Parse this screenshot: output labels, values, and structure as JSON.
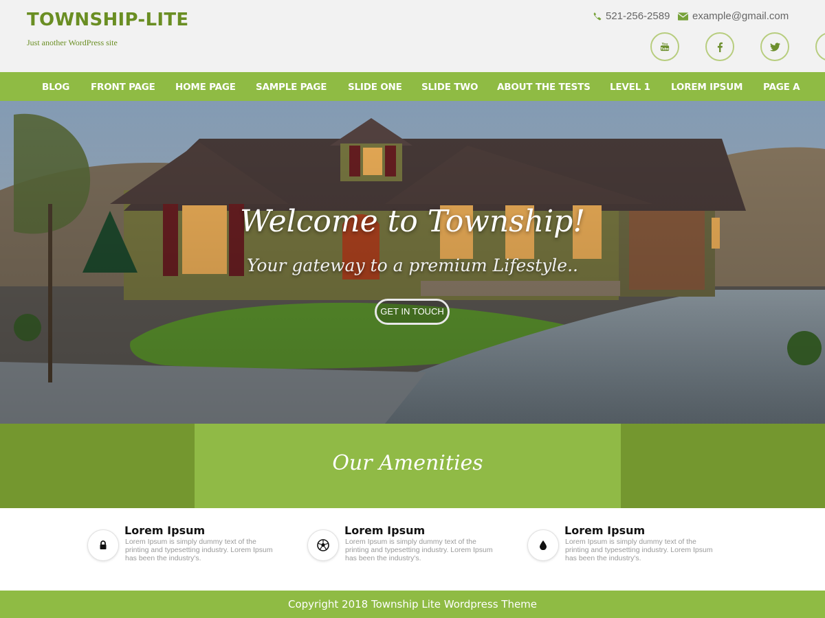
{
  "header": {
    "site_title": "TOWNSHIP-LITE",
    "tagline": "Just another WordPress site",
    "phone": "521-256-2589",
    "email": "example@gmail.com",
    "phone_icon": "phone-icon",
    "email_icon": "envelope-icon",
    "socials": [
      "youtube-icon",
      "facebook-icon",
      "twitter-icon",
      "rss-icon"
    ]
  },
  "nav": {
    "items": [
      {
        "label": "BLOG"
      },
      {
        "label": "FRONT PAGE"
      },
      {
        "label": "HOME PAGE"
      },
      {
        "label": "SAMPLE PAGE"
      },
      {
        "label": "SLIDE ONE"
      },
      {
        "label": "SLIDE TWO"
      },
      {
        "label": "ABOUT THE TESTS"
      },
      {
        "label": "LEVEL 1"
      },
      {
        "label": "LOREM IPSUM"
      },
      {
        "label": "PAGE A"
      }
    ]
  },
  "hero": {
    "title": "Welcome to Township!",
    "subtitle": "Your gateway to a premium Lifestyle..",
    "button_label": "GET IN TOUCH"
  },
  "amenities": {
    "heading": "Our Amenities",
    "items": [
      {
        "icon": "lock-icon",
        "title": "Lorem Ipsum",
        "text": "Lorem Ipsum is simply dummy text of the printing and typesetting industry. Lorem Ipsum has been the industry's."
      },
      {
        "icon": "soccer-ball-icon",
        "title": "Lorem Ipsum",
        "text": "Lorem Ipsum is simply dummy text of the printing and typesetting industry. Lorem Ipsum has been the industry's."
      },
      {
        "icon": "water-drop-icon",
        "title": "Lorem Ipsum",
        "text": "Lorem Ipsum is simply dummy text of the printing and typesetting industry. Lorem Ipsum has been the industry's."
      }
    ]
  },
  "footer": {
    "copyright": "Copyright 2018 Township Lite Wordpress Theme"
  },
  "colors": {
    "brand_green": "#8fbb44",
    "dark_green": "#74972f",
    "title_green": "#6a8e23"
  }
}
